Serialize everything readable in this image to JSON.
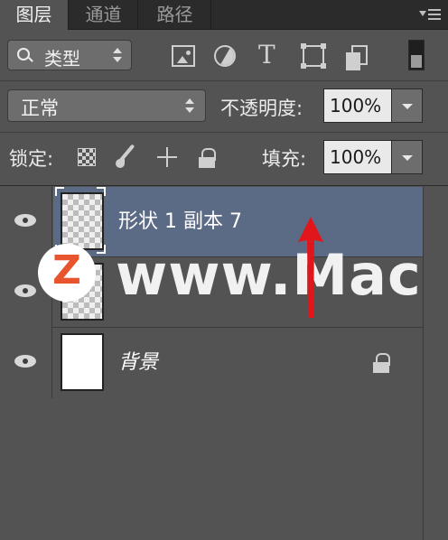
{
  "tabs": [
    {
      "label": "图层",
      "active": true
    },
    {
      "label": "通道",
      "active": false
    },
    {
      "label": "路径",
      "active": false
    }
  ],
  "filter": {
    "kind_label": "类型",
    "icons": [
      "image-filter-icon",
      "adjustment-filter-icon",
      "type-filter-icon",
      "shape-filter-icon",
      "smart-object-filter-icon"
    ],
    "type_glyph": "T"
  },
  "blend": {
    "mode": "正常",
    "opacity_label": "不透明度:",
    "opacity_value": "100%"
  },
  "lock": {
    "label": "锁定:",
    "fill_label": "填充:",
    "fill_value": "100%"
  },
  "layers": [
    {
      "name": "形状 1 副本 7",
      "selected": true,
      "thumbnail": "transparent"
    },
    {
      "name": "",
      "selected": false,
      "thumbnail": "transparent"
    },
    {
      "name": "背景",
      "selected": false,
      "thumbnail": "white",
      "locked": true
    }
  ],
  "watermark": {
    "logo_letter": "Z",
    "text": "www.Mac"
  },
  "colors": {
    "panel_bg": "#535353",
    "selected_layer": "#5b6b85",
    "annotation_arrow": "#e0161b",
    "watermark_logo": "#e8542e"
  }
}
